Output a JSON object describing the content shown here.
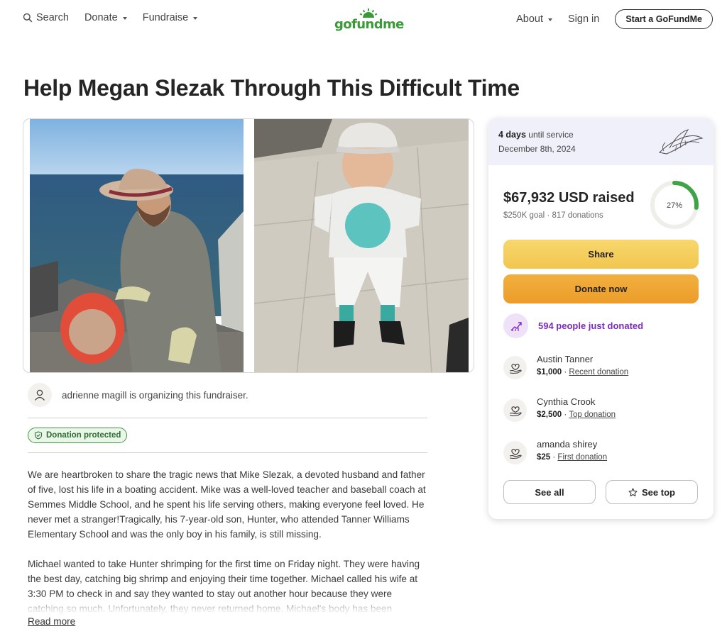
{
  "nav": {
    "search_label": "Search",
    "donate_label": "Donate",
    "fundraise_label": "Fundraise",
    "logo_text": "gofundme",
    "about_label": "About",
    "signin_label": "Sign in",
    "start_label": "Start a GoFundMe"
  },
  "page": {
    "title": "Help Megan Slezak Through This Difficult Time"
  },
  "organizer": {
    "text": "adrienne magill is organizing this fundraiser."
  },
  "badge": {
    "label": "Donation protected"
  },
  "story": {
    "paragraphs": [
      "We are heartbroken to share the tragic news that Mike Slezak, a devoted husband and father of five, lost his life in a boating accident. Mike was a well-loved teacher and baseball coach at Semmes Middle School, and he spent his life serving others, making everyone feel loved. He never met a stranger!Tragically, his 7-year-old son, Hunter, who attended Tanner Williams Elementary School and was the only boy in his family, is still missing.",
      "Michael wanted to take Hunter shrimping for the first time on Friday night. They were having the best day, catching big shrimp and enjoying their time together. Michael called his wife at 3:30 PM to check in and say they wanted to stay out another hour because they were catching so much. Unfortunately, they never returned home. Michael's body has been"
    ],
    "read_more": "Read more"
  },
  "card": {
    "days_bold": "4 days",
    "days_rest": "until service",
    "service_date": "December 8th, 2024",
    "raised": "$67,932 USD raised",
    "goal_text": "$250K goal",
    "donations_text": "817 donations",
    "progress_label": "27%",
    "progress": 0.27,
    "share_label": "Share",
    "donate_now_label": "Donate now",
    "just_donated": "594 people just donated",
    "donors": [
      {
        "name": "Austin Tanner",
        "amount": "$1,000",
        "kind": "Recent donation"
      },
      {
        "name": "Cynthia Crook",
        "amount": "$2,500",
        "kind": "Top donation"
      },
      {
        "name": "amanda shirey",
        "amount": "$25",
        "kind": "First donation"
      }
    ],
    "see_all_label": "See all",
    "see_top_label": "See top"
  },
  "colors": {
    "brand_green": "#3a9a38",
    "share_yellow": "#f2c64e",
    "donate_orange": "#ec9c2a",
    "purple": "#7a2bbf",
    "progress_green": "#3fa447"
  },
  "icons": [
    "search-icon",
    "caret-down-icon",
    "user-icon",
    "shield-check-icon",
    "trending-up-icon",
    "heart-hand-icon",
    "star-icon",
    "memorial-leaf-icon"
  ]
}
